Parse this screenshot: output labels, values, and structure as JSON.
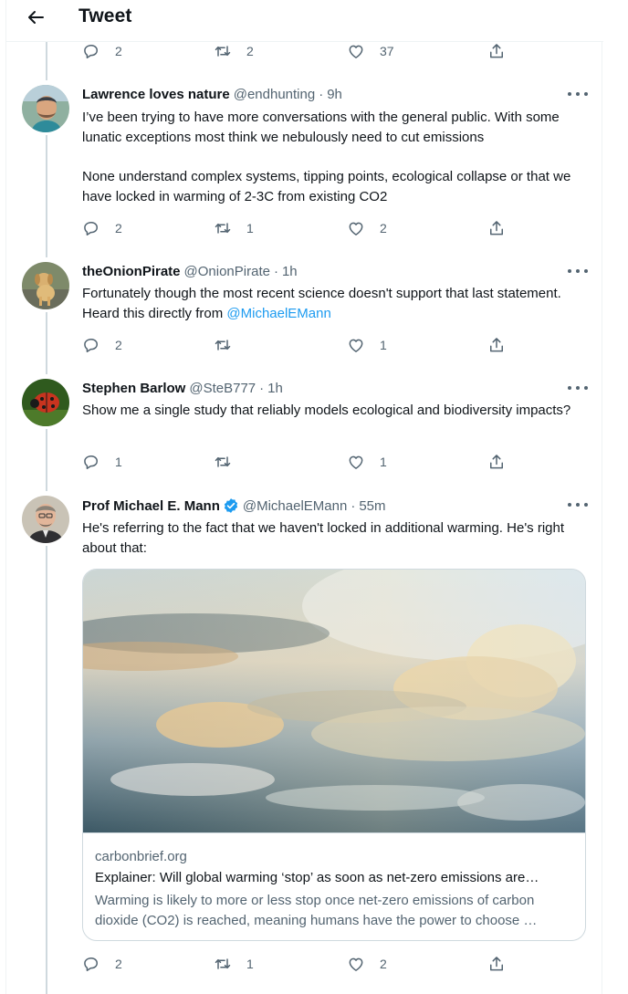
{
  "header": {
    "title": "Tweet",
    "back_icon": "arrow-left-icon"
  },
  "top_actions": {
    "replies": "2",
    "retweets": "2",
    "likes": "37"
  },
  "tweets": [
    {
      "name": "Lawrence loves nature",
      "handle": "@endhunting",
      "sep": "·",
      "time": "9h",
      "text1": "I’ve been trying to have more  conversations with the general public. With some lunatic exceptions most think we nebulously need to cut emissions",
      "text2": "None understand complex systems, tipping points, ecological collapse or that we have locked in warming of 2-3C from existing CO2",
      "replies": "2",
      "retweets": "1",
      "likes": "2"
    },
    {
      "name": "theOnionPirate",
      "handle": "@OnionPirate",
      "sep": "·",
      "time": "1h",
      "text": "Fortunately though the most recent science doesn't support that last statement. Heard this directly from ",
      "mention": "@MichaelEMann",
      "replies": "2",
      "retweets": "",
      "likes": "1"
    },
    {
      "name": "Stephen Barlow",
      "handle": "@SteB777",
      "sep": "·",
      "time": "1h",
      "text": "Show me a single study that reliably models ecological and biodiversity impacts?",
      "replies": "1",
      "retweets": "",
      "likes": "1"
    },
    {
      "name": "Prof Michael E. Mann",
      "handle": "@MichaelEMann",
      "sep": "·",
      "time": "55m",
      "text": "He's referring to the fact that we haven't locked in additional warming. He's right about that:",
      "replies": "2",
      "retweets": "1",
      "likes": "2",
      "card": {
        "domain": "carbonbrief.org",
        "title": "Explainer: Will global warming ‘stop’ as soon as net-zero emissions are…",
        "description": "Warming is likely to more or less stop once net-zero emissions of carbon dioxide (CO2) is reached, meaning humans have the power to choose …"
      }
    }
  ],
  "colors": {
    "accent": "#1d9bf0",
    "secondary_text": "#536471",
    "border": "#eff3f4"
  }
}
